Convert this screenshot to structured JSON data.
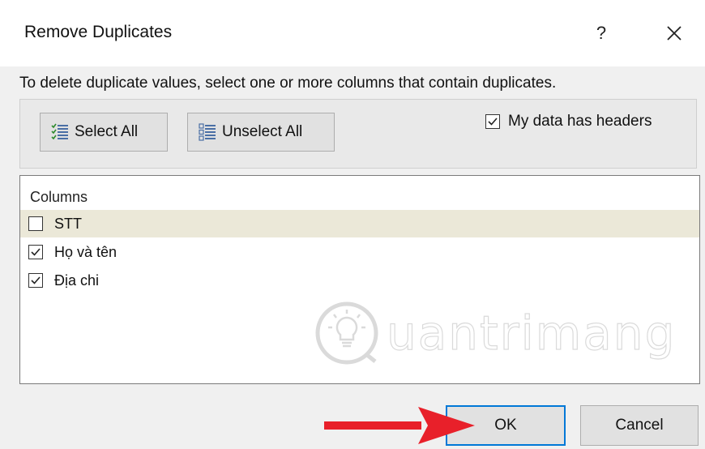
{
  "dialog": {
    "title": "Remove Duplicates",
    "help_label": "?",
    "instruction": "To delete duplicate values, select one or more columns that contain duplicates."
  },
  "toolbar": {
    "select_all_label": "Select All",
    "unselect_all_label": "Unselect All",
    "headers_label": "My data has headers",
    "headers_checked": true
  },
  "columns": {
    "header": "Columns",
    "items": [
      {
        "label": "STT",
        "checked": false
      },
      {
        "label": "Họ và tên",
        "checked": true
      },
      {
        "label": "Địa chi",
        "checked": true
      }
    ]
  },
  "buttons": {
    "ok_label": "OK",
    "cancel_label": "Cancel"
  },
  "watermark": {
    "text": "uantrimang"
  },
  "colors": {
    "accent": "#0078d7",
    "arrow": "#e8202a",
    "selected_row": "#ebe8d8"
  }
}
